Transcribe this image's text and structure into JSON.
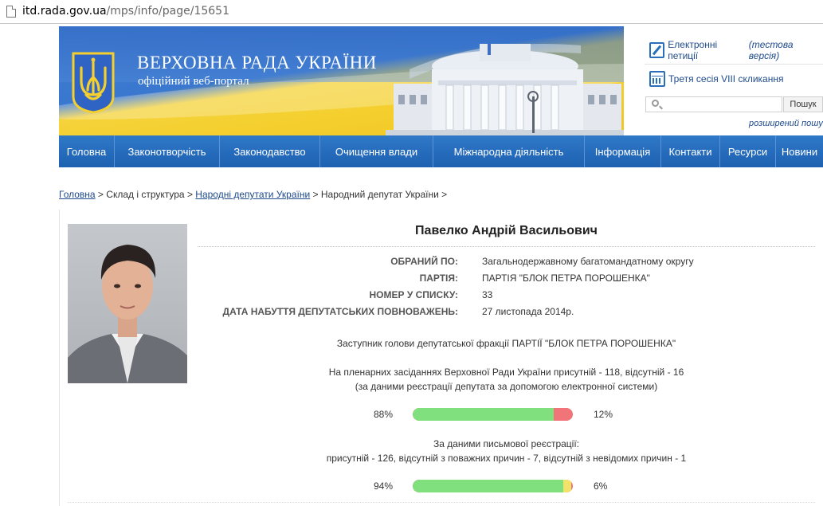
{
  "browser": {
    "url_host": "itd.rada.gov.ua",
    "url_path": "/mps/info/page/15651"
  },
  "header": {
    "title": "ВЕРХОВНА РАДА УКРАЇНИ",
    "subtitle": "офіційний веб-портал",
    "logo_icon": "trident-icon",
    "colors": {
      "blue": "#2f67c2",
      "yellow": "#f4cf2e",
      "nav": "#1e61b1"
    }
  },
  "side": {
    "petitions_label": "Електронні петиції",
    "petitions_note": "(тестова версія)",
    "session_label": "Третя сесія VIII скликання",
    "search_placeholder": "",
    "search_button": "Пошук",
    "advanced_search": "розширений пошук"
  },
  "nav": {
    "items": [
      {
        "label": "Головна"
      },
      {
        "label": "Законотворчість"
      },
      {
        "label": "Законодавство"
      },
      {
        "label": "Очищення влади"
      },
      {
        "label": "Міжнародна діяльність"
      },
      {
        "label": "Інформація"
      },
      {
        "label": "Контакти"
      },
      {
        "label": "Ресурси"
      },
      {
        "label": "Новини"
      }
    ]
  },
  "breadcrumb": {
    "home": "Головна",
    "sep": " > ",
    "structure": "Склад і структура",
    "deputies": "Народні депутати України",
    "current": "Народний депутат України"
  },
  "mp": {
    "name": "Павелко Андрій Васильович",
    "fields": [
      {
        "label": "ОБРАНИЙ ПО:",
        "value": "Загальнодержавному багатомандатному округу"
      },
      {
        "label": "ПАРТІЯ:",
        "value": "ПАРТІЯ \"БЛОК ПЕТРА ПОРОШЕНКА\""
      },
      {
        "label": "НОМЕР У СПИСКУ:",
        "value": "33"
      },
      {
        "label": "ДАТА НАБУТТЯ ДЕПУТАТСЬКИХ ПОВНОВАЖЕНЬ:",
        "value": "27 листопада 2014р."
      }
    ],
    "position": "Заступник голови депутатської фракції ПАРТІЇ \"БЛОК ПЕТРА ПОРОШЕНКА\"",
    "plenary_line1": "На пленарних засіданнях Верховної Ради України присутній - 118, відсутній - 16",
    "plenary_line2": "(за даними реєстрації депутата за допомогою електронної системи)",
    "electronic": {
      "present_pct": 88,
      "present_label": "88%",
      "absent_label": "12%"
    },
    "written_line1": "За даними письмової реєстрації:",
    "written_line2": "присутній - 126, відсутній з поважних причин - 7, відсутній з невідомих причин - 1",
    "written": {
      "present_pct": 94,
      "excused_pct": 5,
      "present_label": "94%",
      "absent_label": "6%"
    }
  }
}
